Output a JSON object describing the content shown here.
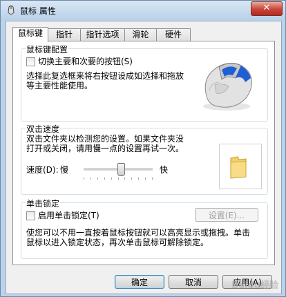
{
  "window": {
    "title": "鼠标 属性",
    "close_label": "✕"
  },
  "tabs": [
    {
      "label": "鼠标键",
      "active": true
    },
    {
      "label": "指针",
      "active": false
    },
    {
      "label": "指针选项",
      "active": false
    },
    {
      "label": "滑轮",
      "active": false
    },
    {
      "label": "硬件",
      "active": false
    }
  ],
  "button_config": {
    "group_label": "鼠标键配置",
    "checkbox_label": "切换主要和次要的按钮(S)",
    "checked": false,
    "description_line1": "选择此复选框来将右按钮设成如选择和拖放",
    "description_line2": "等主要性能使用。"
  },
  "double_click": {
    "group_label": "双击速度",
    "description_line1": "双击文件夹以检测您的设置。如果文件夹没",
    "description_line2": "打开或关闭，请用慢一点的设置再试一次。",
    "speed_label": "速度(D):",
    "slow_label": "慢",
    "fast_label": "快",
    "speed_value_fraction": 0.55
  },
  "click_lock": {
    "group_label": "单击锁定",
    "checkbox_label": "启用单击锁定(T)",
    "checked": false,
    "settings_button": "设置(E)...",
    "description_line1": "使您可以不用一直按着鼠标按钮就可以高亮显示或拖拽。单击",
    "description_line2": "鼠标以进入锁定状态，再次单击鼠标可解除锁定。"
  },
  "footer": {
    "ok": "确定",
    "cancel": "取消",
    "apply": "应用(A)"
  },
  "watermark": "Baidu经验",
  "colors": {
    "window_frame": "#bcd3ea",
    "client_bg": "#f0f0f0",
    "mouse_accent": "#1f5fd6"
  }
}
